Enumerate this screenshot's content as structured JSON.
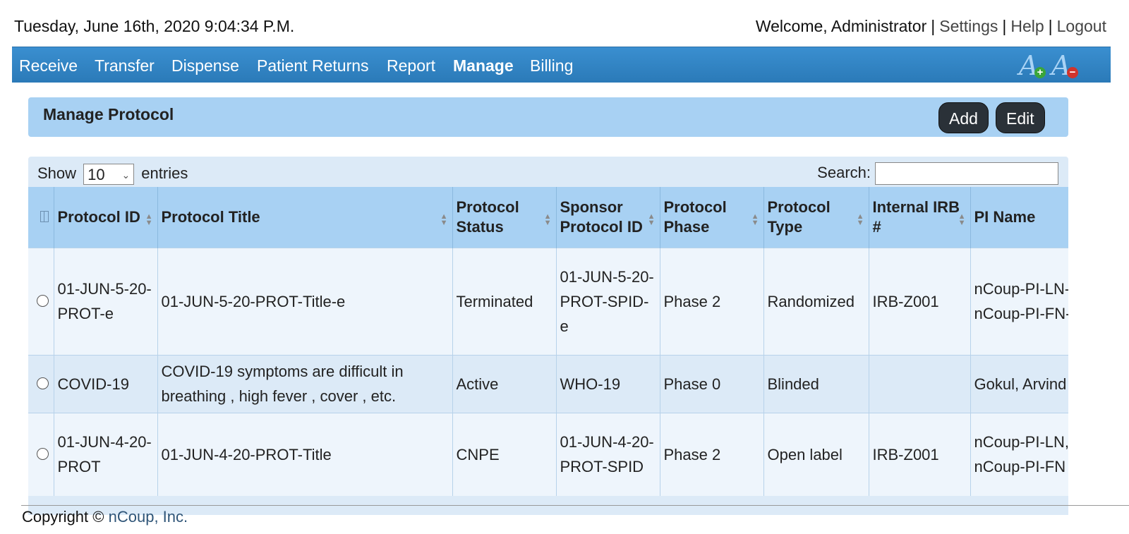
{
  "header": {
    "datetime": "Tuesday, June 16th, 2020 9:04:34 P.M.",
    "welcome": "Welcome, Administrator",
    "links": [
      "Settings",
      "Help",
      "Logout"
    ]
  },
  "nav": {
    "items": [
      "Receive",
      "Transfer",
      "Dispense",
      "Patient Returns",
      "Report",
      "Manage",
      "Billing"
    ],
    "active": "Manage",
    "font_icons": [
      "increase-font-icon",
      "decrease-font-icon"
    ]
  },
  "panel": {
    "title": "Manage Protocol",
    "add_label": "Add",
    "edit_label": "Edit"
  },
  "table_controls": {
    "show_label": "Show",
    "page_size": "10",
    "entries_label": "entries",
    "search_label": "Search:",
    "search_value": ""
  },
  "table": {
    "columns": [
      "Protocol ID",
      "Protocol Title",
      "Protocol Status",
      "Sponsor Protocol ID",
      "Protocol Phase",
      "Protocol Type",
      "Internal IRB #",
      "PI Name"
    ],
    "rows": [
      [
        "01-JUN-5-20-PROT-e",
        "01-JUN-5-20-PROT-Title-e",
        "Terminated",
        "01-JUN-5-20-PROT-SPID-e",
        "Phase 2",
        "Randomized",
        "IRB-Z001",
        "nCoup-PI-LN-e, nCoup-PI-FN-e"
      ],
      [
        "COVID-19",
        "COVID-19 symptoms are difficult in breathing , high fever , cover , etc.",
        "Active",
        "WHO-19",
        "Phase 0",
        "Blinded",
        "",
        "Gokul, Arvind"
      ],
      [
        "01-JUN-4-20-PROT",
        "01-JUN-4-20-PROT-Title",
        "CNPE",
        "01-JUN-4-20-PROT-SPID",
        "Phase 2",
        "Open label",
        "IRB-Z001",
        "nCoup-PI-LN, nCoup-PI-FN"
      ]
    ]
  },
  "footer": {
    "copyright": "Copyright ©",
    "company": "nCoup, Inc."
  },
  "colors": {
    "nav_bg": "#2f84c4",
    "panel_bg": "#a8d1f3",
    "button_bg": "#2a3138"
  }
}
